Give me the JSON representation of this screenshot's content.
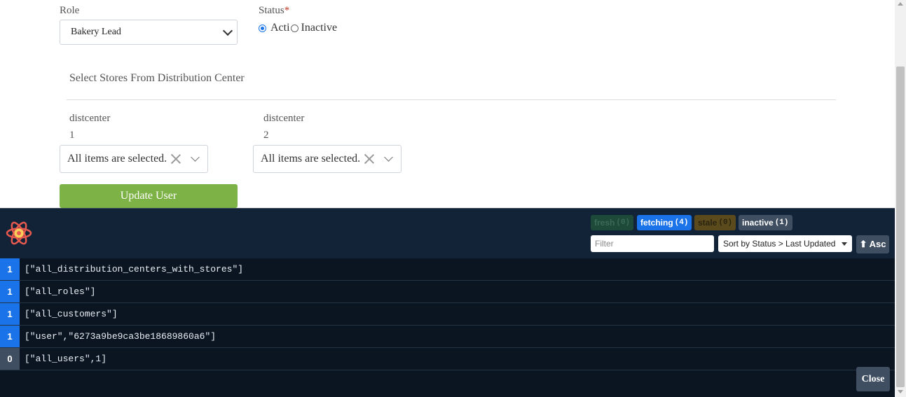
{
  "form": {
    "role_label": "Role",
    "role_value": "Bakery Lead",
    "status_label": "Status",
    "required_mark": "*",
    "status_active": "Acti",
    "status_inactive": "Inactive",
    "stores_heading": "Select Stores From Distribution Center",
    "dc1_name": "distcenter",
    "dc1_num": "1",
    "dc1_value": "All items are selected.",
    "dc2_name": "distcenter",
    "dc2_num": "2",
    "dc2_value": "All items are selected.",
    "update_button": "Update User"
  },
  "devtools": {
    "badges": [
      {
        "label": "fresh",
        "count": "(0)"
      },
      {
        "label": "fetching",
        "count": "(4)"
      },
      {
        "label": "stale",
        "count": "(0)"
      },
      {
        "label": "inactive",
        "count": "(1)"
      }
    ],
    "filter_placeholder": "Filter",
    "sort_value": "Sort by Status > Last Updated",
    "asc_button": "⬆ Asc",
    "queries": [
      {
        "count": "1",
        "key": "[\"all_distribution_centers_with_stores\"]"
      },
      {
        "count": "1",
        "key": "[\"all_roles\"]"
      },
      {
        "count": "1",
        "key": "[\"all_customers\"]"
      },
      {
        "count": "1",
        "key": "[\"user\",\"6273a9be9ca3be18689860a6\"]"
      },
      {
        "count": "0",
        "key": "[\"all_users\",1]"
      }
    ],
    "close_button": "Close"
  },
  "colors": {
    "fetching": "#1a73e8",
    "inactive_count": "#3f4e60",
    "update_button": "#7db246"
  }
}
